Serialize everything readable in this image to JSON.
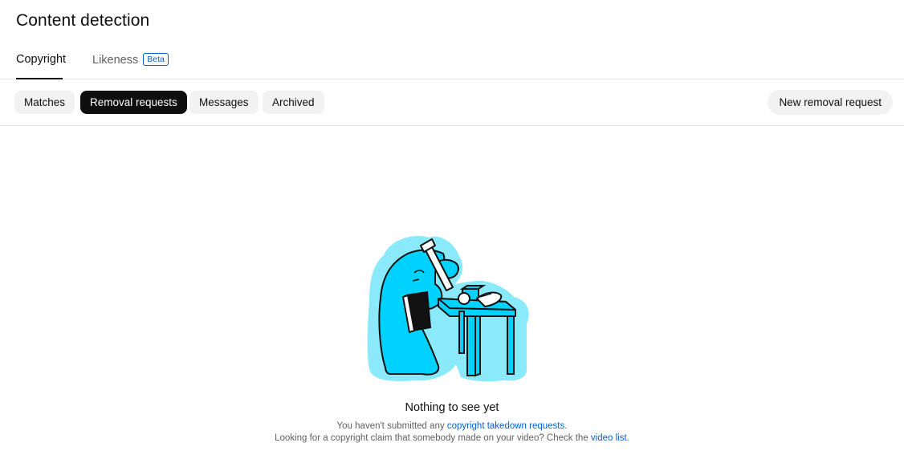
{
  "page": {
    "title": "Content detection"
  },
  "tabs": [
    {
      "label": "Copyright",
      "active": true
    },
    {
      "label": "Likeness",
      "badge": "Beta",
      "active": false
    }
  ],
  "filters": [
    {
      "label": "Matches",
      "selected": false
    },
    {
      "label": "Removal requests",
      "selected": true
    },
    {
      "label": "Messages",
      "selected": false
    },
    {
      "label": "Archived",
      "selected": false
    }
  ],
  "actions": {
    "new_request_label": "New removal request"
  },
  "empty_state": {
    "title": "Nothing to see yet",
    "line1_prefix": "You haven't submitted any ",
    "line1_link": "copyright takedown requests",
    "line1_suffix": ".",
    "line2_prefix": "Looking for a copyright claim that somebody made on your video? Check the ",
    "line2_link": "video list",
    "line2_suffix": ".",
    "illustration_icon": "empty-state-illustration"
  },
  "colors": {
    "accent_link": "#065fd4",
    "selected_chip": "#0f0f0f",
    "chip_bg": "#f2f2f2",
    "illustration_cyan": "#00d2ff",
    "illustration_halo": "#8ae9fb"
  }
}
